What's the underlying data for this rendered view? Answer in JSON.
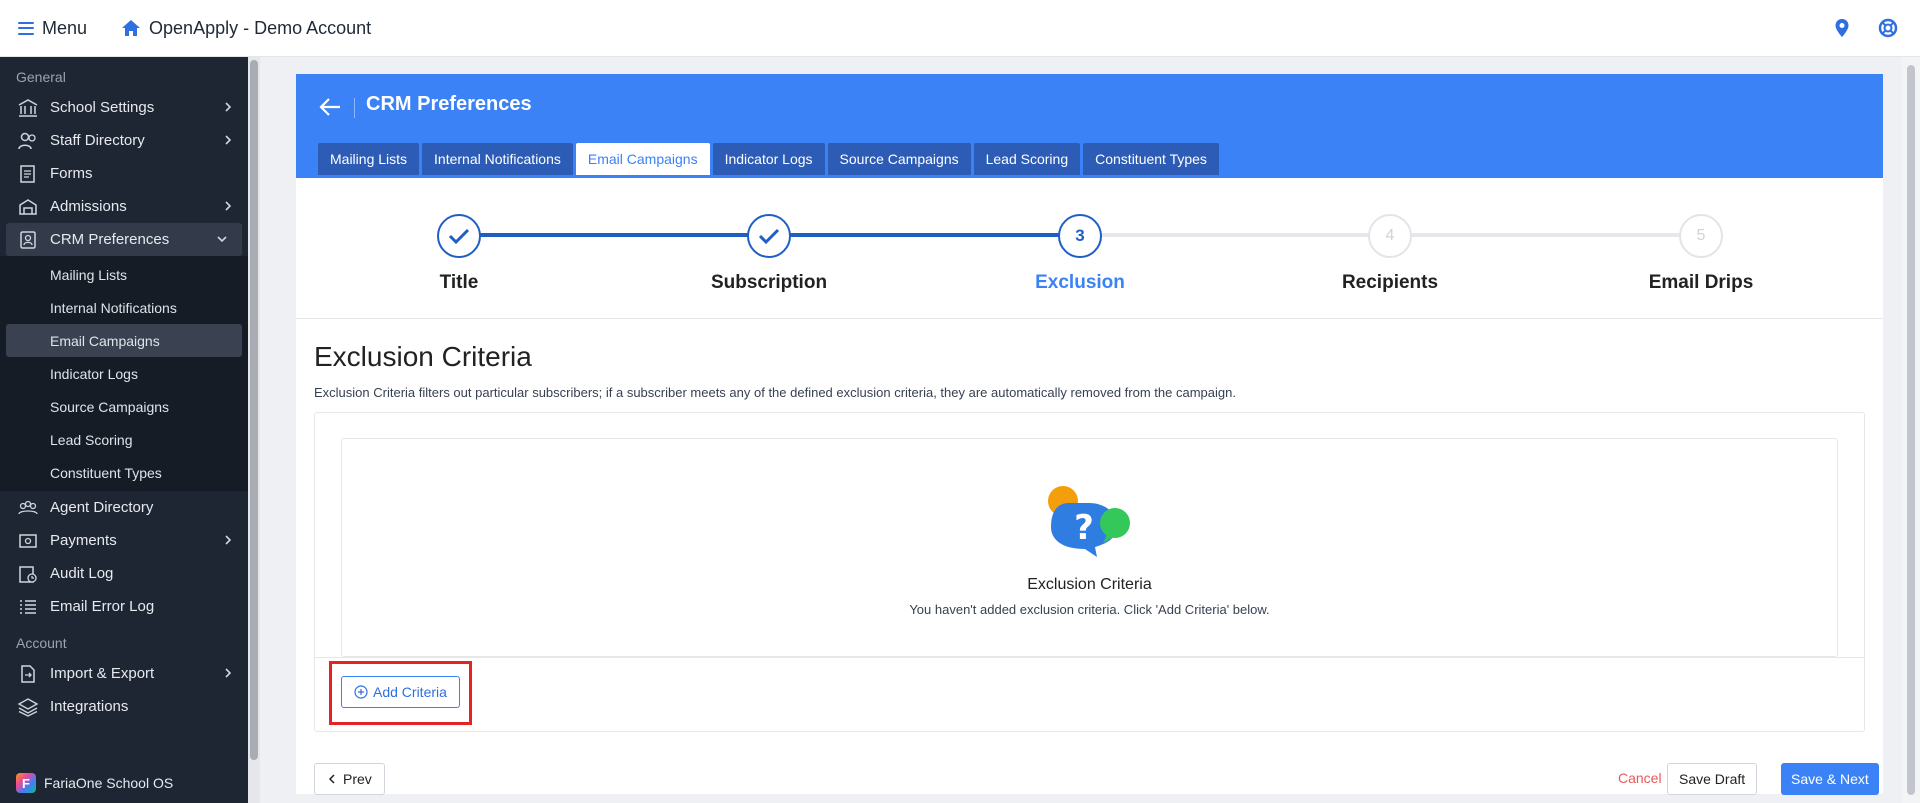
{
  "topbar": {
    "menu_label": "Menu",
    "app_title": "OpenApply - Demo Account"
  },
  "sidebar": {
    "section_general": "General",
    "section_account": "Account",
    "items": {
      "school_settings": "School Settings",
      "staff_directory": "Staff Directory",
      "forms": "Forms",
      "admissions": "Admissions",
      "crm_preferences": "CRM Preferences",
      "agent_directory": "Agent Directory",
      "payments": "Payments",
      "audit_log": "Audit Log",
      "email_error_log": "Email Error Log",
      "import_export": "Import & Export",
      "integrations": "Integrations"
    },
    "crm_sub": [
      "Mailing Lists",
      "Internal Notifications",
      "Email Campaigns",
      "Indicator Logs",
      "Source Campaigns",
      "Lead Scoring",
      "Constituent Types"
    ],
    "footer_brand": "FariaOne School OS"
  },
  "header": {
    "title": "CRM Preferences",
    "tabs": [
      "Mailing Lists",
      "Internal Notifications",
      "Email Campaigns",
      "Indicator Logs",
      "Source Campaigns",
      "Lead Scoring",
      "Constituent Types"
    ],
    "active_tab": "Email Campaigns"
  },
  "stepper": {
    "current_step": 3,
    "steps": [
      {
        "number": "1",
        "label": "Title",
        "state": "done"
      },
      {
        "number": "2",
        "label": "Subscription",
        "state": "done"
      },
      {
        "number": "3",
        "label": "Exclusion",
        "state": "current"
      },
      {
        "number": "4",
        "label": "Recipients",
        "state": "todo"
      },
      {
        "number": "5",
        "label": "Email Drips",
        "state": "todo"
      }
    ]
  },
  "content": {
    "heading": "Exclusion Criteria",
    "description": "Exclusion Criteria filters out particular subscribers; if a subscriber meets any of the defined exclusion criteria, they are automatically removed from the campaign.",
    "empty_title": "Exclusion Criteria",
    "empty_subtitle": "You haven't added exclusion criteria. Click 'Add Criteria' below.",
    "add_button": "Add Criteria"
  },
  "footer": {
    "prev": "Prev",
    "cancel": "Cancel",
    "save_draft": "Save Draft",
    "save_next": "Save & Next"
  },
  "colors": {
    "accent": "#3b82f6",
    "sidebar_bg": "#1f2633",
    "highlight": "#e62323",
    "cancel": "#e85a5a"
  }
}
